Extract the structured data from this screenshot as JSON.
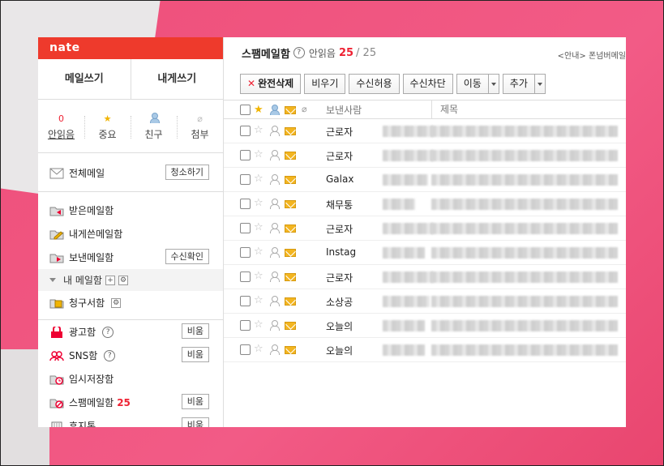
{
  "logo": "nate",
  "compose": {
    "write": "메일쓰기",
    "self": "내게쓰기"
  },
  "quick": {
    "unread_count": "0",
    "unread_label": "안읽음",
    "important_label": "중요",
    "friends_label": "친구",
    "attach_label": "첨부"
  },
  "folders": {
    "all": "전체메일",
    "all_btn": "청소하기",
    "inbox": "받은메일함",
    "self": "내게쓴메일함",
    "sent": "보낸메일함",
    "sent_btn": "수신확인",
    "mymail": "내 메일함",
    "bill": "청구서함",
    "ads": "광고함",
    "ads_btn": "비움",
    "sns": "SNS함",
    "sns_btn": "비움",
    "draft": "임시저장함",
    "spam": "스팸메일함",
    "spam_count": "25",
    "spam_btn": "비움",
    "trash": "휴지통",
    "trash_btn": "비움"
  },
  "main": {
    "title": "스팸메일함",
    "unread_label": "안읽음",
    "unread_count": "25",
    "total": "/ 25",
    "notice": "<안내> 폰넘버메일"
  },
  "toolbar": {
    "delete": "완전삭제",
    "empty": "비우기",
    "allow": "수신허용",
    "block": "수신차단",
    "move": "이동",
    "add": "추가"
  },
  "list_head": {
    "sender": "보낸사람",
    "subject": "제목"
  },
  "rows": [
    {
      "sender": "근로자"
    },
    {
      "sender": "근로자"
    },
    {
      "sender": "Galax"
    },
    {
      "sender": "채무통"
    },
    {
      "sender": "근로자"
    },
    {
      "sender": "Instag"
    },
    {
      "sender": "근로자"
    },
    {
      "sender": "소상공"
    },
    {
      "sender": "오늘의"
    },
    {
      "sender": "오늘의"
    }
  ],
  "colors": {
    "brand": "#ee3a2c",
    "accent_count": "#e22233",
    "background": "#ee4f7a"
  },
  "icons": [
    "star-icon",
    "person-icon",
    "clip-icon",
    "envelope-icon",
    "folder-icon",
    "help-icon",
    "gear-icon",
    "plus-icon"
  ]
}
